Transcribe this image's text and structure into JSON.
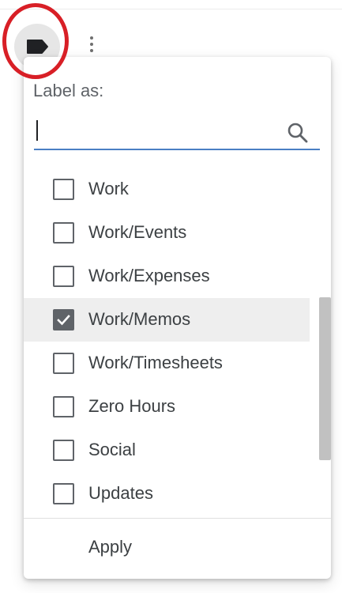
{
  "toolbar": {
    "label_button_icon": "label-tag-icon",
    "more_icon": "more-vertical-icon"
  },
  "dropdown": {
    "heading": "Label as:",
    "search": {
      "value": "",
      "placeholder": "",
      "icon": "search-icon"
    },
    "labels": [
      {
        "name": "Work",
        "checked": false
      },
      {
        "name": "Work/Events",
        "checked": false
      },
      {
        "name": "Work/Expenses",
        "checked": false
      },
      {
        "name": "Work/Memos",
        "checked": true
      },
      {
        "name": "Work/Timesheets",
        "checked": false
      },
      {
        "name": "Zero Hours",
        "checked": false
      },
      {
        "name": "Social",
        "checked": false
      },
      {
        "name": "Updates",
        "checked": false
      }
    ],
    "apply_label": "Apply"
  },
  "colors": {
    "annotation_circle": "#d81f26",
    "focus_underline": "#4a7fc4",
    "checked_row_bg": "#eeeeee"
  }
}
